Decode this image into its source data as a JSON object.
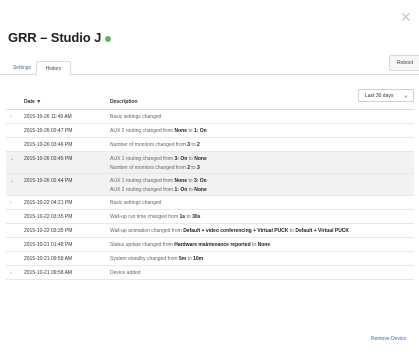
{
  "window": {
    "close_icon": "close-icon"
  },
  "header": {
    "title": "GRR – Studio J",
    "status_color": "#5cb85c"
  },
  "toolbar": {
    "reboot_label": "Reboot"
  },
  "tabs": [
    {
      "label": "Settings",
      "active": false
    },
    {
      "label": "History",
      "active": true
    }
  ],
  "filter": {
    "value": "Last 30 days"
  },
  "table": {
    "columns": [
      "Date",
      "Description"
    ],
    "rows": [
      {
        "date": "2015-10-26 11:49 AM",
        "expand": "right",
        "lines": [
          [
            {
              "t": "Basic settings changed"
            }
          ]
        ]
      },
      {
        "date": "2015-10-26 03:47 PM",
        "lines": [
          [
            {
              "t": "AUX 2 routing changed from "
            },
            {
              "t": "None",
              "b": 1
            },
            {
              "t": " to "
            },
            {
              "t": "1: On",
              "b": 1
            }
          ]
        ]
      },
      {
        "date": "2015-10-26 03:46 PM",
        "lines": [
          [
            {
              "t": "Number of monitors changed from "
            },
            {
              "t": "3",
              "b": 1
            },
            {
              "t": " to "
            },
            {
              "t": "2",
              "b": 1
            }
          ]
        ]
      },
      {
        "date": "2015-10-26 03:45 PM",
        "expand": "down",
        "shaded": true,
        "lines": [
          [
            {
              "t": "AUX 1 routing changed from "
            },
            {
              "t": "3: On",
              "b": 1
            },
            {
              "t": " to "
            },
            {
              "t": "None",
              "b": 1
            }
          ],
          [
            {
              "t": "Number of monitors changed from "
            },
            {
              "t": "2",
              "b": 1
            },
            {
              "t": " to "
            },
            {
              "t": "3",
              "b": 1
            }
          ]
        ]
      },
      {
        "date": "2015-10-26 02:44 PM",
        "expand": "down",
        "shaded": true,
        "lines": [
          [
            {
              "t": "AUX 1 routing changed from "
            },
            {
              "t": "None",
              "b": 1
            },
            {
              "t": " to "
            },
            {
              "t": "3: On",
              "b": 1
            }
          ],
          [
            {
              "t": "AUX 2 routing changed from "
            },
            {
              "t": "1: On",
              "b": 1
            },
            {
              "t": " to "
            },
            {
              "t": "None",
              "b": 1
            }
          ]
        ]
      },
      {
        "date": "2015-10-22 04:21 PM",
        "expand": "right",
        "lines": [
          [
            {
              "t": "Basic settings changed"
            }
          ]
        ]
      },
      {
        "date": "2015-10-22 03:35 PM",
        "lines": [
          [
            {
              "t": "Wall-up run time changed from "
            },
            {
              "t": "1s",
              "b": 1
            },
            {
              "t": " to "
            },
            {
              "t": "30s",
              "b": 1
            }
          ]
        ]
      },
      {
        "date": "2015-10-22 03:35 PM",
        "lines": [
          [
            {
              "t": "Wall-up animation changed from "
            },
            {
              "t": "Default + video conferencing + Virtual PUCK",
              "b": 1
            },
            {
              "t": " to "
            },
            {
              "t": "Default + Virtual PUCK",
              "b": 1
            }
          ]
        ]
      },
      {
        "date": "2015-10-21 01:48 PM",
        "lines": [
          [
            {
              "t": "Status update changed from "
            },
            {
              "t": "Hardware maintenance reported",
              "b": 1
            },
            {
              "t": " to "
            },
            {
              "t": "None",
              "b": 1
            }
          ]
        ]
      },
      {
        "date": "2015-10-21 09:59 AM",
        "lines": [
          [
            {
              "t": "System standby changed from "
            },
            {
              "t": "5m",
              "b": 1
            },
            {
              "t": " to "
            },
            {
              "t": "10m",
              "b": 1
            }
          ]
        ]
      },
      {
        "date": "2015-10-21 09:58 AM",
        "expand": "right",
        "lines": [
          [
            {
              "t": "Device added"
            }
          ]
        ]
      }
    ]
  },
  "footer": {
    "remove_label": "Remove Device"
  }
}
